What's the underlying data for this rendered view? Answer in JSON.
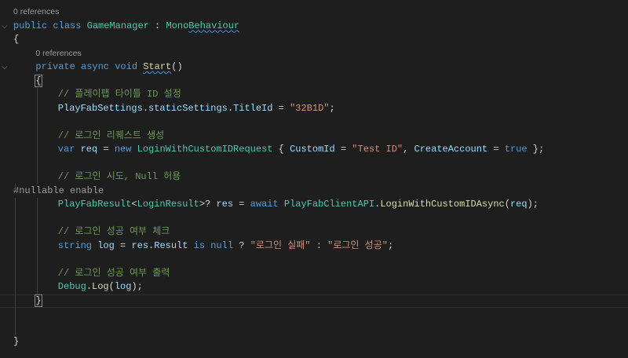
{
  "colors": {
    "kw": "#569cd6",
    "type": "#4ec9b0",
    "cmt": "#6a9955",
    "str": "#ce9178",
    "var": "#9cdcfe",
    "fn": "#dcdcaa",
    "plain": "#d4d4d4",
    "pre": "#9b9b9b"
  },
  "lines": [
    {
      "refs": "0 references",
      "indent": 0
    },
    {
      "indent": 0,
      "fold": true,
      "tokens": [
        [
          "public ",
          "kw"
        ],
        [
          "class ",
          "kw"
        ],
        [
          "GameManager",
          "type"
        ],
        [
          " : ",
          "plain"
        ],
        [
          "Mono",
          "type"
        ],
        [
          "Behaviour",
          "type",
          "squig"
        ]
      ]
    },
    {
      "indent": 0,
      "tokens": [
        [
          "{",
          "plain"
        ]
      ]
    },
    {
      "refs": "0 references",
      "indent": 4
    },
    {
      "indent": 4,
      "fold": true,
      "tokens": [
        [
          "private ",
          "kw"
        ],
        [
          "async ",
          "kw"
        ],
        [
          "void ",
          "kw"
        ],
        [
          "Start",
          "fn",
          "squig"
        ],
        [
          "()",
          "plain"
        ]
      ]
    },
    {
      "indent": 4,
      "tokens": [
        [
          "{",
          "plain",
          "brace"
        ]
      ]
    },
    {
      "indent": 8,
      "tokens": [
        [
          "// 플레이팹 타이틀 ID 설정",
          "cmt"
        ]
      ]
    },
    {
      "indent": 8,
      "tokens": [
        [
          "PlayFabSettings",
          "var"
        ],
        [
          ".",
          "plain"
        ],
        [
          "staticSettings",
          "var"
        ],
        [
          ".",
          "plain"
        ],
        [
          "TitleId",
          "var"
        ],
        [
          " = ",
          "plain"
        ],
        [
          "\"32B1D\"",
          "str"
        ],
        [
          ";",
          "plain"
        ]
      ]
    },
    {
      "indent": 0,
      "tokens": []
    },
    {
      "indent": 8,
      "tokens": [
        [
          "// 로그인 리퀘스트 생성",
          "cmt"
        ]
      ]
    },
    {
      "indent": 8,
      "tokens": [
        [
          "var ",
          "kw"
        ],
        [
          "req",
          "var"
        ],
        [
          " = ",
          "plain"
        ],
        [
          "new ",
          "kw"
        ],
        [
          "LoginWithCustomIDRequest",
          "type"
        ],
        [
          " { ",
          "plain"
        ],
        [
          "CustomId",
          "var"
        ],
        [
          " = ",
          "plain"
        ],
        [
          "\"Test ID\"",
          "str"
        ],
        [
          ", ",
          "plain"
        ],
        [
          "CreateAccount",
          "var"
        ],
        [
          " = ",
          "plain"
        ],
        [
          "true",
          "kw"
        ],
        [
          " };",
          "plain"
        ]
      ]
    },
    {
      "indent": 0,
      "tokens": []
    },
    {
      "indent": 8,
      "tokens": [
        [
          "// 로그인 시도, Null 허용",
          "cmt"
        ]
      ]
    },
    {
      "indent": 0,
      "tokens": [
        [
          "#nullable enable",
          "pre"
        ]
      ]
    },
    {
      "indent": 8,
      "tokens": [
        [
          "PlayFabResult",
          "type"
        ],
        [
          "<",
          "plain"
        ],
        [
          "LoginResult",
          "type"
        ],
        [
          ">? ",
          "plain"
        ],
        [
          "res",
          "var"
        ],
        [
          " = ",
          "plain"
        ],
        [
          "await ",
          "kw"
        ],
        [
          "PlayFabClientAPI",
          "type"
        ],
        [
          ".",
          "plain"
        ],
        [
          "LoginWithCustomIDAsync",
          "fn"
        ],
        [
          "(",
          "plain"
        ],
        [
          "req",
          "var"
        ],
        [
          ");",
          "plain"
        ]
      ]
    },
    {
      "indent": 0,
      "tokens": []
    },
    {
      "indent": 8,
      "tokens": [
        [
          "// 로그인 성공 여부 체크",
          "cmt"
        ]
      ]
    },
    {
      "indent": 8,
      "tokens": [
        [
          "string ",
          "kw"
        ],
        [
          "log",
          "var"
        ],
        [
          " = ",
          "plain"
        ],
        [
          "res",
          "var"
        ],
        [
          ".",
          "plain"
        ],
        [
          "Result",
          "var"
        ],
        [
          " is ",
          "kw"
        ],
        [
          "null",
          "kw"
        ],
        [
          " ? ",
          "plain"
        ],
        [
          "\"로그인 실패\"",
          "str"
        ],
        [
          " : ",
          "plain"
        ],
        [
          "\"로그인 성공\"",
          "str"
        ],
        [
          ";",
          "plain"
        ]
      ]
    },
    {
      "indent": 0,
      "tokens": []
    },
    {
      "indent": 8,
      "tokens": [
        [
          "// 로그인 성공 여부 출력",
          "cmt"
        ]
      ]
    },
    {
      "indent": 8,
      "tokens": [
        [
          "Debug",
          "type"
        ],
        [
          ".",
          "plain"
        ],
        [
          "Log",
          "fn"
        ],
        [
          "(",
          "plain"
        ],
        [
          "log",
          "var"
        ],
        [
          ");",
          "plain"
        ]
      ]
    },
    {
      "indent": 4,
      "current": true,
      "tokens": [
        [
          "}",
          "plain",
          "brace"
        ]
      ]
    },
    {
      "indent": 0,
      "tokens": []
    },
    {
      "indent": 0,
      "tokens": []
    },
    {
      "indent": 0,
      "tokens": [
        [
          "}",
          "plain"
        ]
      ]
    }
  ]
}
